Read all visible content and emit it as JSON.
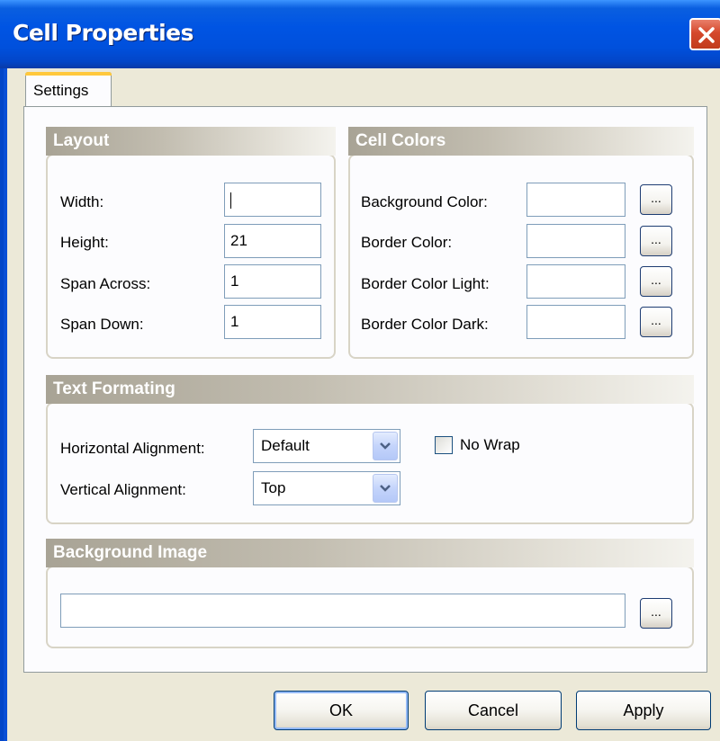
{
  "window": {
    "title": "Cell Properties"
  },
  "tabs": [
    {
      "label": "Settings"
    }
  ],
  "layout": {
    "heading": "Layout",
    "width_label": "Width:",
    "width_value": "",
    "height_label": "Height:",
    "height_value": "21",
    "span_across_label": "Span Across:",
    "span_across_value": "1",
    "span_down_label": "Span Down:",
    "span_down_value": "1"
  },
  "cell_colors": {
    "heading": "Cell Colors",
    "background_label": "Background Color:",
    "background_value": "",
    "border_label": "Border Color:",
    "border_value": "",
    "border_light_label": "Border Color Light:",
    "border_light_value": "",
    "border_dark_label": "Border Color Dark:",
    "border_dark_value": "",
    "browse_label": "..."
  },
  "text_formatting": {
    "heading": "Text Formating",
    "horizontal_label": "Horizontal Alignment:",
    "horizontal_value": "Default",
    "vertical_label": "Vertical Alignment:",
    "vertical_value": "Top",
    "no_wrap_label": "No Wrap",
    "no_wrap_checked": false
  },
  "background_image": {
    "heading": "Background Image",
    "path_value": "",
    "browse_label": "..."
  },
  "buttons": {
    "ok": "OK",
    "cancel": "Cancel",
    "apply": "Apply"
  },
  "colors": {
    "titlebar": "#0054e3",
    "close": "#d5482c",
    "face": "#ece9d8",
    "tab_highlight": "#ffc83c"
  }
}
